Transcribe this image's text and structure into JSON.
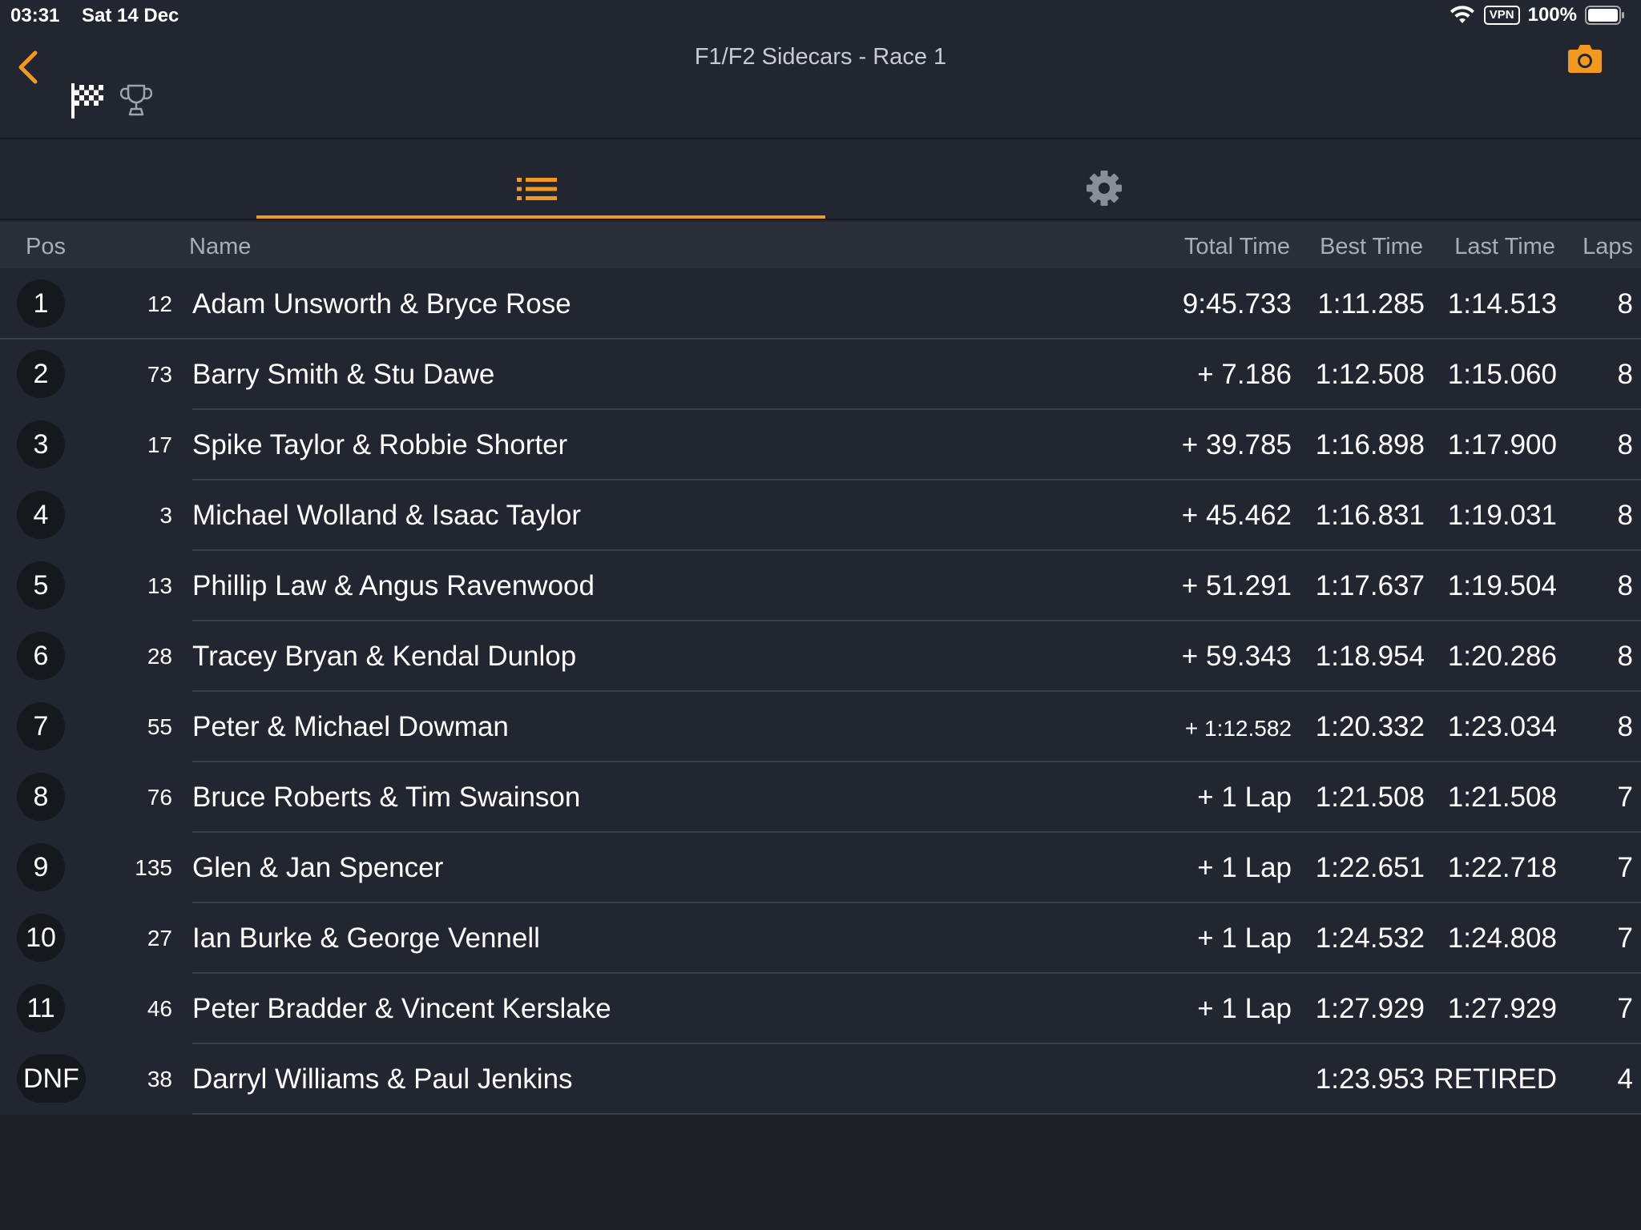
{
  "status_bar": {
    "time": "03:31",
    "date": "Sat 14 Dec",
    "vpn": "VPN",
    "battery": "100%"
  },
  "header": {
    "title": "F1/F2 Sidecars - Race 1",
    "icons": [
      "back-chevron-icon",
      "checkered-flag-icon",
      "trophy-icon",
      "camera-icon"
    ]
  },
  "tabs": [
    {
      "icon": "list-icon",
      "active": true
    },
    {
      "icon": "gear-icon",
      "active": false
    }
  ],
  "table": {
    "columns": {
      "pos": "Pos",
      "name": "Name",
      "total": "Total Time",
      "best": "Best Time",
      "last": "Last Time",
      "laps": "Laps"
    },
    "rows": [
      {
        "pos": "1",
        "num": "12",
        "name": "Adam Unsworth & Bryce Rose",
        "total": "9:45.733",
        "best": "1:11.285",
        "last": "1:14.513",
        "laps": "8"
      },
      {
        "pos": "2",
        "num": "73",
        "name": "Barry Smith & Stu Dawe",
        "total": "+ 7.186",
        "best": "1:12.508",
        "last": "1:15.060",
        "laps": "8"
      },
      {
        "pos": "3",
        "num": "17",
        "name": "Spike Taylor & Robbie Shorter",
        "total": "+ 39.785",
        "best": "1:16.898",
        "last": "1:17.900",
        "laps": "8"
      },
      {
        "pos": "4",
        "num": "3",
        "name": "Michael Wolland & Isaac Taylor",
        "total": "+ 45.462",
        "best": "1:16.831",
        "last": "1:19.031",
        "laps": "8"
      },
      {
        "pos": "5",
        "num": "13",
        "name": "Phillip Law & Angus Ravenwood",
        "total": "+ 51.291",
        "best": "1:17.637",
        "last": "1:19.504",
        "laps": "8"
      },
      {
        "pos": "6",
        "num": "28",
        "name": "Tracey Bryan & Kendal Dunlop",
        "total": "+ 59.343",
        "best": "1:18.954",
        "last": "1:20.286",
        "laps": "8"
      },
      {
        "pos": "7",
        "num": "55",
        "name": "Peter & Michael Dowman",
        "total": "+ 1:12.582",
        "best": "1:20.332",
        "last": "1:23.034",
        "laps": "8"
      },
      {
        "pos": "8",
        "num": "76",
        "name": "Bruce Roberts & Tim Swainson",
        "total": "+ 1 Lap",
        "best": "1:21.508",
        "last": "1:21.508",
        "laps": "7"
      },
      {
        "pos": "9",
        "num": "135",
        "name": "Glen & Jan Spencer",
        "total": "+ 1 Lap",
        "best": "1:22.651",
        "last": "1:22.718",
        "laps": "7"
      },
      {
        "pos": "10",
        "num": "27",
        "name": "Ian Burke & George Vennell",
        "total": "+ 1 Lap",
        "best": "1:24.532",
        "last": "1:24.808",
        "laps": "7"
      },
      {
        "pos": "11",
        "num": "46",
        "name": "Peter Bradder & Vincent Kerslake",
        "total": "+ 1 Lap",
        "best": "1:27.929",
        "last": "1:27.929",
        "laps": "7"
      },
      {
        "pos": "DNF",
        "num": "38",
        "name": "Darryl Williams & Paul Jenkins",
        "total": "",
        "best": "1:23.953",
        "last": "RETIRED",
        "laps": "4"
      }
    ]
  },
  "colors": {
    "accent": "#f39a1e",
    "background": "#222630",
    "header_row": "#2a2e38",
    "badge": "#15181d"
  }
}
